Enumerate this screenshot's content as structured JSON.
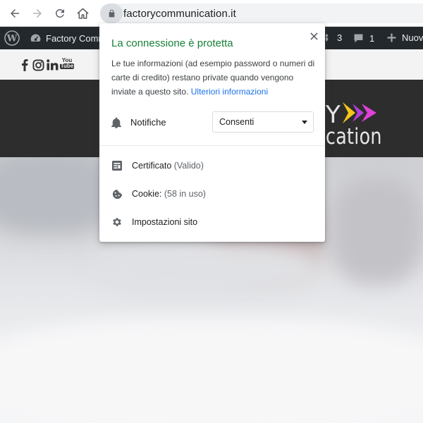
{
  "browser": {
    "url": "factorycommunication.it",
    "icons": [
      "back-arrow-icon",
      "forward-arrow-icon",
      "reload-icon",
      "home-icon",
      "lock-icon"
    ]
  },
  "admin_bar": {
    "site_name": "Factory Comm",
    "updates_count": "3",
    "comments_count": "1",
    "new_label": "Nuov"
  },
  "site": {
    "logo_letter": "Y",
    "logo_text": "cation",
    "social": [
      "f",
      "instagram",
      "in",
      "You Tube"
    ],
    "social_youtube_top": "You",
    "social_youtube_bottom": "Tube",
    "colors": {
      "header_bg": "#2d2d2d",
      "arrow_yellow": "#f5c518",
      "arrow_purple": "#b43fd8",
      "arrow_magenta": "#e040d8"
    }
  },
  "popup": {
    "title": "La connessione è protetta",
    "description": "Le tue informazioni (ad esempio password o numeri di carte di credito) restano private quando vengono inviate a questo sito.",
    "learn_more": "Ulteriori informazioni",
    "permission": {
      "label": "Notifiche",
      "value": "Consenti"
    },
    "certificate": {
      "label": "Certificato",
      "detail": "(Valido)"
    },
    "cookies": {
      "label": "Cookie:",
      "detail": "(58 in uso)"
    },
    "site_settings": "Impostazioni sito",
    "colors": {
      "title_green": "#188038",
      "link_blue": "#1a73e8"
    }
  }
}
